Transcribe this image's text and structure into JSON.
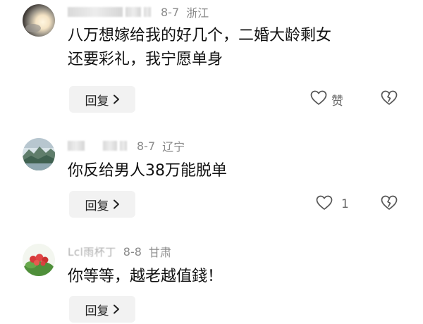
{
  "comments": [
    {
      "name": "",
      "date": "8-7",
      "location": "浙江",
      "lines": [
        "八万想嫁给我的好几个，二婚大龄剩女",
        "还要彩礼，我宁愿单身"
      ],
      "reply_label": "回复",
      "like_label": "赞",
      "avatar_icon": "avatar-photo-icon"
    },
    {
      "name": "",
      "date": "8-7",
      "location": "辽宁",
      "lines": [
        "你反给男人38万能脱单"
      ],
      "reply_label": "回复",
      "like_label": "1",
      "avatar_icon": "avatar-landscape-icon"
    },
    {
      "name": "Lcl雨杯丁",
      "date": "8-8",
      "location": "甘肃",
      "lines": [
        "你等等，越老越值錢！"
      ],
      "reply_label": "回复",
      "like_label": "",
      "avatar_icon": "avatar-flowers-icon"
    }
  ],
  "icons": {
    "like": "heart-outline-icon",
    "dislike": "broken-heart-icon",
    "reply_chevron": "chevron-right-icon"
  },
  "colors": {
    "meta_text": "#8a8a8a",
    "button_bg": "#f2f2f2",
    "content_text": "#111111"
  }
}
